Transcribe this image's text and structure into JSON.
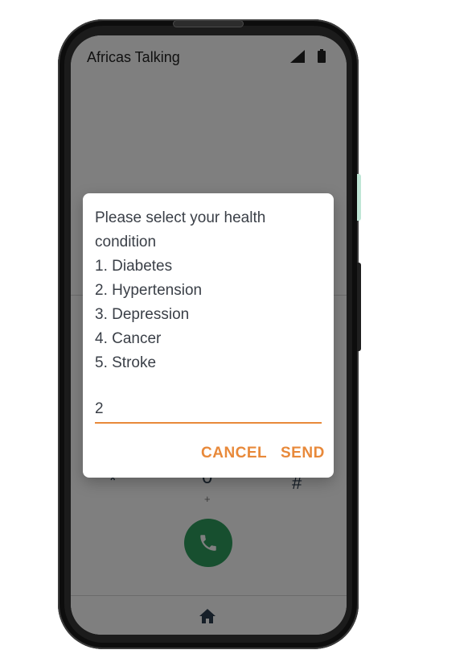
{
  "status_bar": {
    "app_title": "Africas Talking",
    "signal_icon": "signal-icon",
    "battery_icon": "battery-icon"
  },
  "dialpad": {
    "key_star": "*",
    "key_zero": "0",
    "key_zero_sub": "+",
    "key_hash": "#",
    "call_icon": "phone-icon",
    "call_color": "#2e9e5e"
  },
  "nav": {
    "home_icon": "home-icon"
  },
  "dialog": {
    "message_lines": [
      "Please select your health",
      "condition",
      "1. Diabetes",
      "2. Hypertension",
      "3. Depression",
      "4. Cancer",
      "5. Stroke"
    ],
    "input_value": "2",
    "cancel_label": "CANCEL",
    "send_label": "SEND",
    "accent_color": "#e8893a"
  }
}
